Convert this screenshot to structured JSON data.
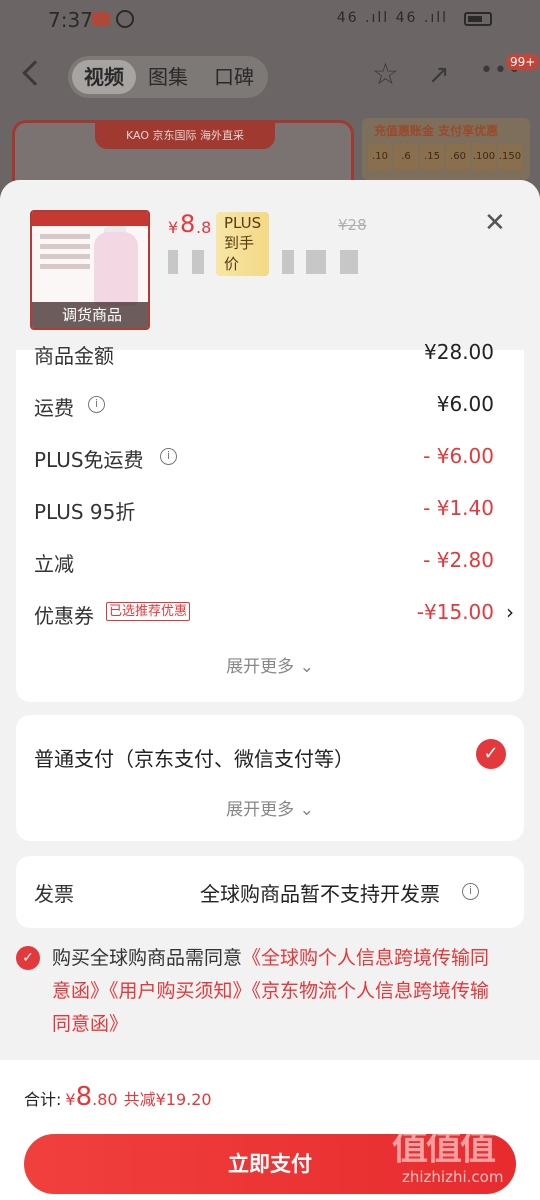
{
  "status": {
    "time": "7:37",
    "signal": "46 .ıll 46 .ıll"
  },
  "nav": {
    "tabs": [
      "视频",
      "图集",
      "口碑"
    ],
    "badge": "99+"
  },
  "banner": {
    "head": "KAO  京东国际 海外直采",
    "right_title": "充值惠账金 支付享优惠",
    "coins": [
      ".10",
      ".6",
      ".15",
      ".60",
      ".100",
      ".150"
    ]
  },
  "product": {
    "thumb_label": "调货商品",
    "price_symbol": "¥",
    "price_int": "8",
    "price_dec": ".8",
    "plus_tag": "PLUS到手价",
    "orig_price": "¥28"
  },
  "fees": {
    "rows": [
      {
        "label": "商品金额",
        "value": "¥28.00"
      },
      {
        "label": "运费",
        "value": "¥6.00"
      },
      {
        "label": "PLUS免运费",
        "value": "- ¥6.00"
      },
      {
        "label": "PLUS 95折",
        "value": "- ¥1.40"
      },
      {
        "label": "立减",
        "value": "- ¥2.80"
      },
      {
        "label": "优惠券",
        "value": "-¥15.00",
        "tag": "已选推荐优惠"
      }
    ],
    "expand": "展开更多 ⌄"
  },
  "payment": {
    "label": "普通支付（京东支付、微信支付等）",
    "expand": "展开更多 ⌄"
  },
  "invoice": {
    "label": "发票",
    "value": "全球购商品暂不支持开发票"
  },
  "agreement": {
    "prefix": "购买全球购商品需同意",
    "links": [
      "《全球购个人信息跨境传输同意函》",
      "《用户购买须知》",
      "《京东物流个人信息跨境传输同意函》"
    ]
  },
  "footer": {
    "total_label": "合计:",
    "total_symbol": "¥",
    "total_int": "8",
    "total_dec": ".80",
    "discount": "共减¥19.20",
    "pay_button": "立即支付"
  },
  "watermark": {
    "main": "值值值",
    "sub": "zhizhizhi.com"
  },
  "colors": {
    "accent": "#e4393c",
    "sheet_bg": "#f2f2f2"
  }
}
